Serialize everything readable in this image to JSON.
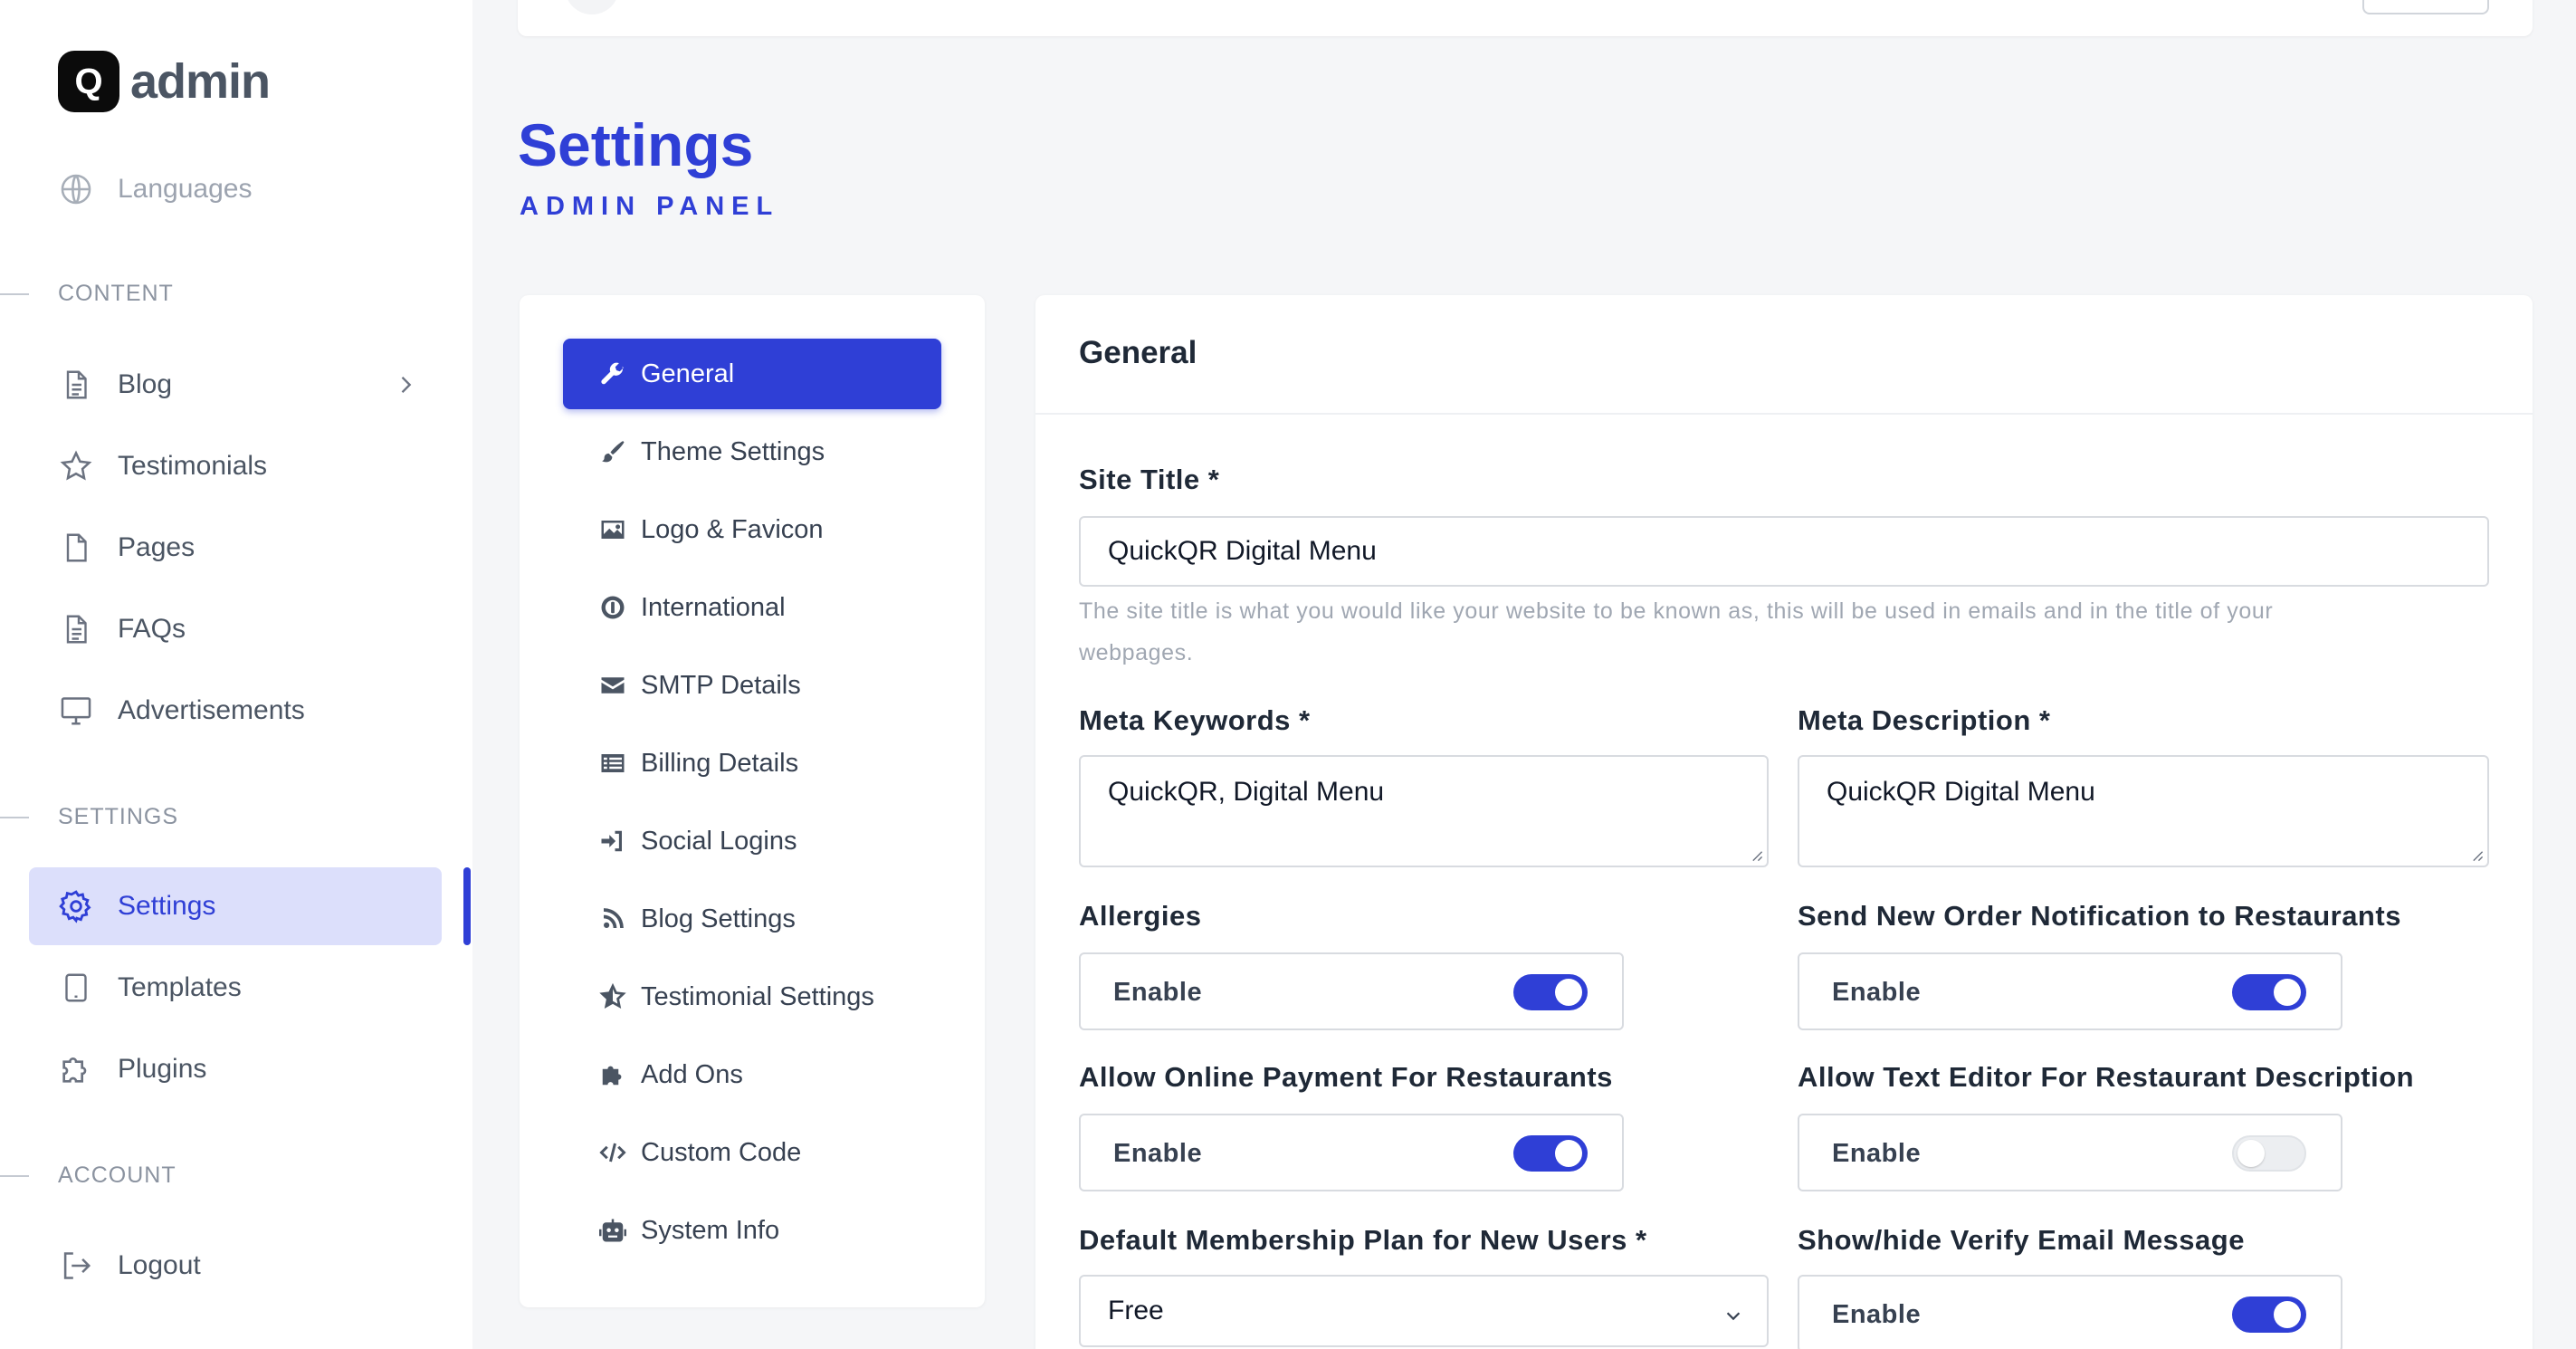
{
  "brand": {
    "logo_letter": "Q",
    "name": "admin"
  },
  "sidebar": {
    "top_item": {
      "label": "Languages",
      "icon": "globe-icon"
    },
    "sections": [
      {
        "label": "CONTENT"
      },
      {
        "label": "SETTINGS"
      },
      {
        "label": "ACCOUNT"
      }
    ],
    "content_items": [
      {
        "label": "Blog",
        "icon": "document-icon"
      },
      {
        "label": "Testimonials",
        "icon": "star-icon"
      },
      {
        "label": "Pages",
        "icon": "page-icon"
      },
      {
        "label": "FAQs",
        "icon": "document-icon"
      },
      {
        "label": "Advertisements",
        "icon": "monitor-icon"
      }
    ],
    "settings_items": [
      {
        "label": "Settings",
        "icon": "gear-icon"
      },
      {
        "label": "Templates",
        "icon": "tablet-icon"
      },
      {
        "label": "Plugins",
        "icon": "puzzle-icon"
      }
    ],
    "account_items": [
      {
        "label": "Logout",
        "icon": "logout-icon"
      }
    ]
  },
  "header": {
    "title": "Settings",
    "subtitle": "ADMIN PANEL"
  },
  "settings_menu": [
    {
      "label": "General",
      "icon": "wrench-icon"
    },
    {
      "label": "Theme Settings",
      "icon": "brush-icon"
    },
    {
      "label": "Logo & Favicon",
      "icon": "image-icon"
    },
    {
      "label": "International",
      "icon": "info-circle-icon"
    },
    {
      "label": "SMTP Details",
      "icon": "envelope-icon"
    },
    {
      "label": "Billing Details",
      "icon": "list-icon"
    },
    {
      "label": "Social Logins",
      "icon": "sign-in-icon"
    },
    {
      "label": "Blog Settings",
      "icon": "rss-icon"
    },
    {
      "label": "Testimonial Settings",
      "icon": "star-half-icon"
    },
    {
      "label": "Add Ons",
      "icon": "puzzle-icon"
    },
    {
      "label": "Custom Code",
      "icon": "code-icon"
    },
    {
      "label": "System Info",
      "icon": "robot-icon"
    }
  ],
  "form": {
    "title": "General",
    "site_title": {
      "label": "Site Title *",
      "value": "QuickQR Digital Menu",
      "help_line1": "The site title is what you would like your website to be known as, this will be used in emails and in the title of your",
      "help_line2": "webpages."
    },
    "meta_keywords": {
      "label": "Meta Keywords *",
      "value": "QuickQR, Digital Menu"
    },
    "meta_description": {
      "label": "Meta Description *",
      "value": "QuickQR Digital Menu"
    },
    "toggles": [
      {
        "label": "Allergies",
        "state": "Enable",
        "on": true
      },
      {
        "label": "Send New Order Notification to Restaurants",
        "state": "Enable",
        "on": true
      },
      {
        "label": "Allow Online Payment For Restaurants",
        "state": "Enable",
        "on": true
      },
      {
        "label": "Allow Text Editor For Restaurant Description",
        "state": "Enable",
        "on": false
      },
      {
        "label": "Show/hide Verify Email Message",
        "state": "Enable",
        "on": true
      }
    ],
    "membership_plan": {
      "label": "Default Membership Plan for New Users *",
      "value": "Free"
    }
  },
  "colors": {
    "accent": "#2f3fd6",
    "active_bg": "#dcdffb",
    "toggle_off": "#eceef1"
  }
}
